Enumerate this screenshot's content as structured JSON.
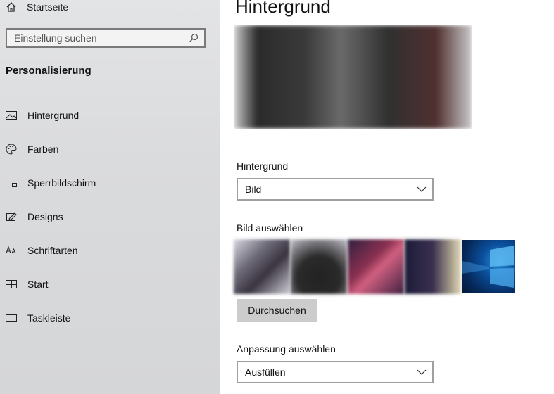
{
  "sidebar": {
    "home_label": "Startseite",
    "search_placeholder": "Einstellung suchen",
    "section_title": "Personalisierung",
    "items": [
      {
        "label": "Hintergrund",
        "icon": "picture-icon"
      },
      {
        "label": "Farben",
        "icon": "palette-icon"
      },
      {
        "label": "Sperrbildschirm",
        "icon": "lock-screen-icon"
      },
      {
        "label": "Designs",
        "icon": "themes-icon"
      },
      {
        "label": "Schriftarten",
        "icon": "font-icon"
      },
      {
        "label": "Start",
        "icon": "start-icon"
      },
      {
        "label": "Taskleiste",
        "icon": "taskbar-icon"
      }
    ]
  },
  "main": {
    "title": "Hintergrund",
    "background_label": "Hintergrund",
    "background_value": "Bild",
    "choose_image_label": "Bild auswählen",
    "browse_label": "Durchsuchen",
    "fit_label": "Anpassung auswählen",
    "fit_value": "Ausfüllen"
  }
}
